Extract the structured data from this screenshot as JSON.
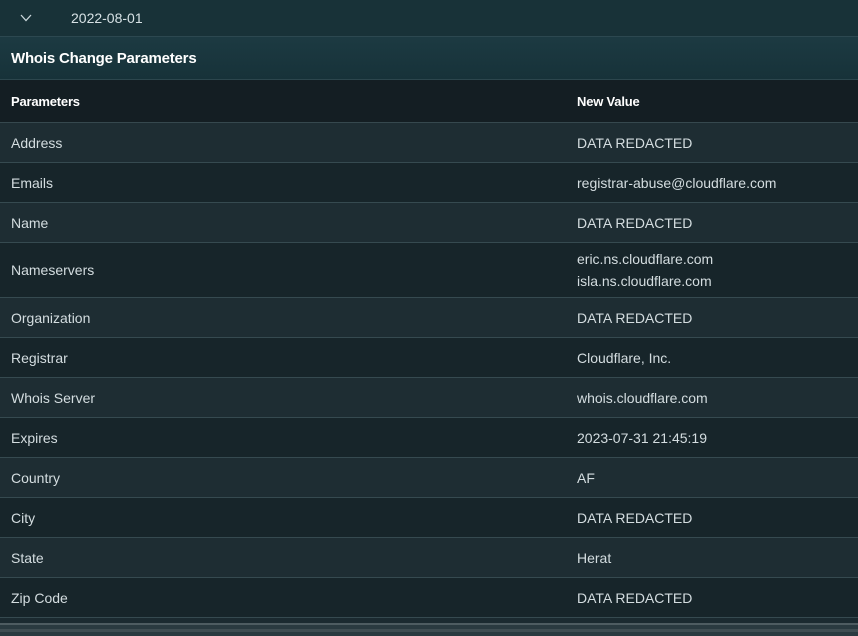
{
  "date_row": {
    "date": "2022-08-01",
    "toggle_icon": "chevron-down-icon"
  },
  "section": {
    "title": "Whois Change Parameters"
  },
  "table": {
    "headers": {
      "parameter": "Parameters",
      "value": "New Value"
    },
    "rows": [
      {
        "parameter": "Address",
        "values": [
          "DATA REDACTED"
        ]
      },
      {
        "parameter": "Emails",
        "values": [
          "registrar-abuse@cloudflare.com"
        ]
      },
      {
        "parameter": "Name",
        "values": [
          "DATA REDACTED"
        ]
      },
      {
        "parameter": "Nameservers",
        "values": [
          "eric.ns.cloudflare.com",
          "isla.ns.cloudflare.com"
        ]
      },
      {
        "parameter": "Organization",
        "values": [
          "DATA REDACTED"
        ]
      },
      {
        "parameter": "Registrar",
        "values": [
          "Cloudflare, Inc."
        ]
      },
      {
        "parameter": "Whois Server",
        "values": [
          "whois.cloudflare.com"
        ]
      },
      {
        "parameter": "Expires",
        "values": [
          "2023-07-31 21:45:19"
        ]
      },
      {
        "parameter": "Country",
        "values": [
          "AF"
        ]
      },
      {
        "parameter": "City",
        "values": [
          "DATA REDACTED"
        ]
      },
      {
        "parameter": "State",
        "values": [
          "Herat"
        ]
      },
      {
        "parameter": "Zip Code",
        "values": [
          "DATA REDACTED"
        ]
      }
    ]
  }
}
